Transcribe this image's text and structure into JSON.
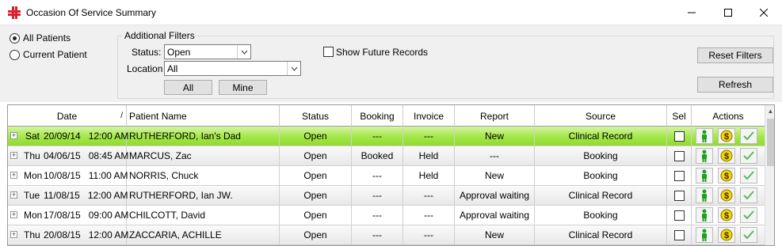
{
  "window": {
    "title": "Occasion Of Service Summary"
  },
  "colors": {
    "selected_row": "#a6e84e",
    "accent_red": "#d8202f"
  },
  "patient_scope": {
    "all_label": "All Patients",
    "current_label": "Current Patient",
    "selected": "all"
  },
  "filters": {
    "group_title": "Additional Filters",
    "status_label": "Status:",
    "status_value": "Open",
    "location_label": "Location",
    "location_value": "All",
    "all_button": "All",
    "mine_button": "Mine",
    "show_future_label": "Show Future Records",
    "show_future_checked": false,
    "reset_button": "Reset Filters",
    "refresh_button": "Refresh"
  },
  "table": {
    "columns": [
      "Date",
      "Patient Name",
      "Status",
      "Booking",
      "Invoice",
      "Report",
      "Source",
      "Sel",
      "Actions"
    ],
    "sort_indicator": "/",
    "rows": [
      {
        "day": "Sat",
        "date": "20/09/14",
        "time": "12:00 AM",
        "patient": "RUTHERFORD, Ian's Dad",
        "status": "Open",
        "booking": "---",
        "invoice": "---",
        "report": "New",
        "source": "Clinical Record",
        "selected": true
      },
      {
        "day": "Thu",
        "date": "04/06/15",
        "time": "08:45 AM",
        "patient": "MARCUS, Zac",
        "status": "Open",
        "booking": "Booked",
        "invoice": "Held",
        "report": "---",
        "source": "Booking",
        "selected": false
      },
      {
        "day": "Mon",
        "date": "10/08/15",
        "time": "11:00 AM",
        "patient": "NORRIS, Chuck",
        "status": "Open",
        "booking": "---",
        "invoice": "Held",
        "report": "New",
        "source": "Booking",
        "selected": false
      },
      {
        "day": "Tue",
        "date": "11/08/15",
        "time": "12:00 AM",
        "patient": "RUTHERFORD, Ian JW.",
        "status": "Open",
        "booking": "---",
        "invoice": "---",
        "report": "Approval waiting",
        "source": "Clinical Record",
        "selected": false
      },
      {
        "day": "Mon",
        "date": "17/08/15",
        "time": "09:00 AM",
        "patient": "CHILCOTT, David",
        "status": "Open",
        "booking": "---",
        "invoice": "---",
        "report": "Approval waiting",
        "source": "Booking",
        "selected": false
      },
      {
        "day": "Thu",
        "date": "20/08/15",
        "time": "12:00 AM",
        "patient": "ZACCARIA, ACHILLE",
        "status": "Open",
        "booking": "---",
        "invoice": "---",
        "report": "New",
        "source": "Clinical Record",
        "selected": false
      }
    ]
  }
}
